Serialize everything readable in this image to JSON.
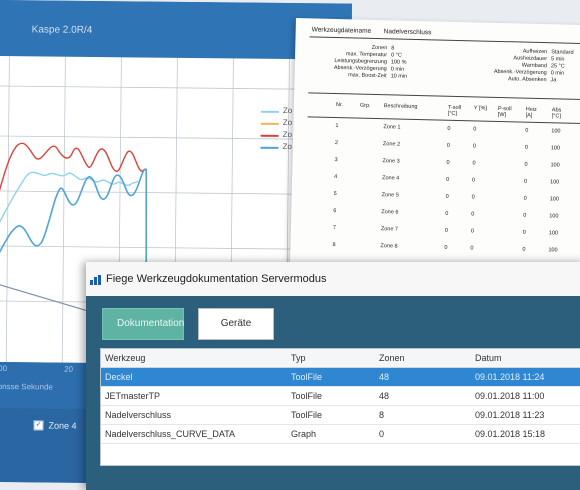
{
  "chart_window": {
    "title": "Kaspe 2.0R/4",
    "legend": [
      "Zo",
      "Zo",
      "Zo",
      "Zo"
    ],
    "legend_colors": [
      "#8fd3e8",
      "#f2b35c",
      "#d9433a",
      "#4fa3d8"
    ],
    "x_ticks": [
      "00",
      "20"
    ],
    "x_axis_label": "ionsse Sekunde",
    "zone_toggle": {
      "label": "Zone 4",
      "checked": true
    }
  },
  "report": {
    "header_left": "Werkzeugdateiname",
    "header_right": "Nadelverschluss",
    "params_left": [
      [
        "Zonen",
        "8"
      ],
      [
        "max. Temperatur",
        "0 °C"
      ],
      [
        "Leistungsbegrenzung",
        "100 %"
      ],
      [
        "Absenk.-Verzögerung",
        "0 min"
      ],
      [
        "max. Boost-Zeit",
        "10 min"
      ]
    ],
    "params_right": [
      [
        "Aufheizen",
        "Standard"
      ],
      [
        "Ausheizdauer",
        "5 min"
      ],
      [
        "Warnband",
        "25 °C"
      ],
      [
        "Absenk.-Verzögerung",
        "0 min"
      ],
      [
        "Auto. Absenken",
        "Ja"
      ]
    ],
    "columns": [
      "Nr.",
      "Grp.",
      "Beschreibung",
      "T-soll [°C]",
      "Y [%]",
      "P-soll [W]",
      "Heiz [A]",
      "Abs [°C]"
    ],
    "rows": [
      [
        "1",
        "",
        "Zone 1",
        "0",
        "0",
        "0",
        "100"
      ],
      [
        "2",
        "",
        "Zone 2",
        "0",
        "0",
        "0",
        "100"
      ],
      [
        "3",
        "",
        "Zone 3",
        "0",
        "0",
        "0",
        "100"
      ],
      [
        "4",
        "",
        "Zone 4",
        "0",
        "0",
        "0",
        "100"
      ],
      [
        "5",
        "",
        "Zone 5",
        "0",
        "0",
        "0",
        "100"
      ],
      [
        "6",
        "",
        "Zone 6",
        "0",
        "0",
        "0",
        "100"
      ],
      [
        "7",
        "",
        "Zone 7",
        "0",
        "0",
        "0",
        "100"
      ],
      [
        "8",
        "",
        "Zone 8",
        "0",
        "0",
        "0",
        "100"
      ]
    ]
  },
  "app": {
    "title": "Fiege Werkzeugdokumentation Servermodus",
    "buttons": {
      "documentation": "Dokumentation",
      "devices": "Geräte"
    },
    "columns": [
      "Werkzeug",
      "Typ",
      "Zonen",
      "Datum"
    ],
    "rows": [
      {
        "tool": "Deckel",
        "type": "ToolFile",
        "zones": "48",
        "date": "09.01.2018 11:24",
        "selected": true
      },
      {
        "tool": "JETmasterTP",
        "type": "ToolFile",
        "zones": "48",
        "date": "09.01.2018 11:00",
        "selected": false
      },
      {
        "tool": "Nadelverschluss",
        "type": "ToolFile",
        "zones": "8",
        "date": "09.01.2018 11:23",
        "selected": false
      },
      {
        "tool": "Nadelverschluss_CURVE_DATA",
        "type": "Graph",
        "zones": "0",
        "date": "09.01.2018 15:18",
        "selected": false
      }
    ]
  },
  "colors": {
    "chart_blue": "#2f74b5",
    "selection_blue": "#2f86d1",
    "app_body": "#2c5f7c",
    "primary_button": "#5fb3a3"
  }
}
